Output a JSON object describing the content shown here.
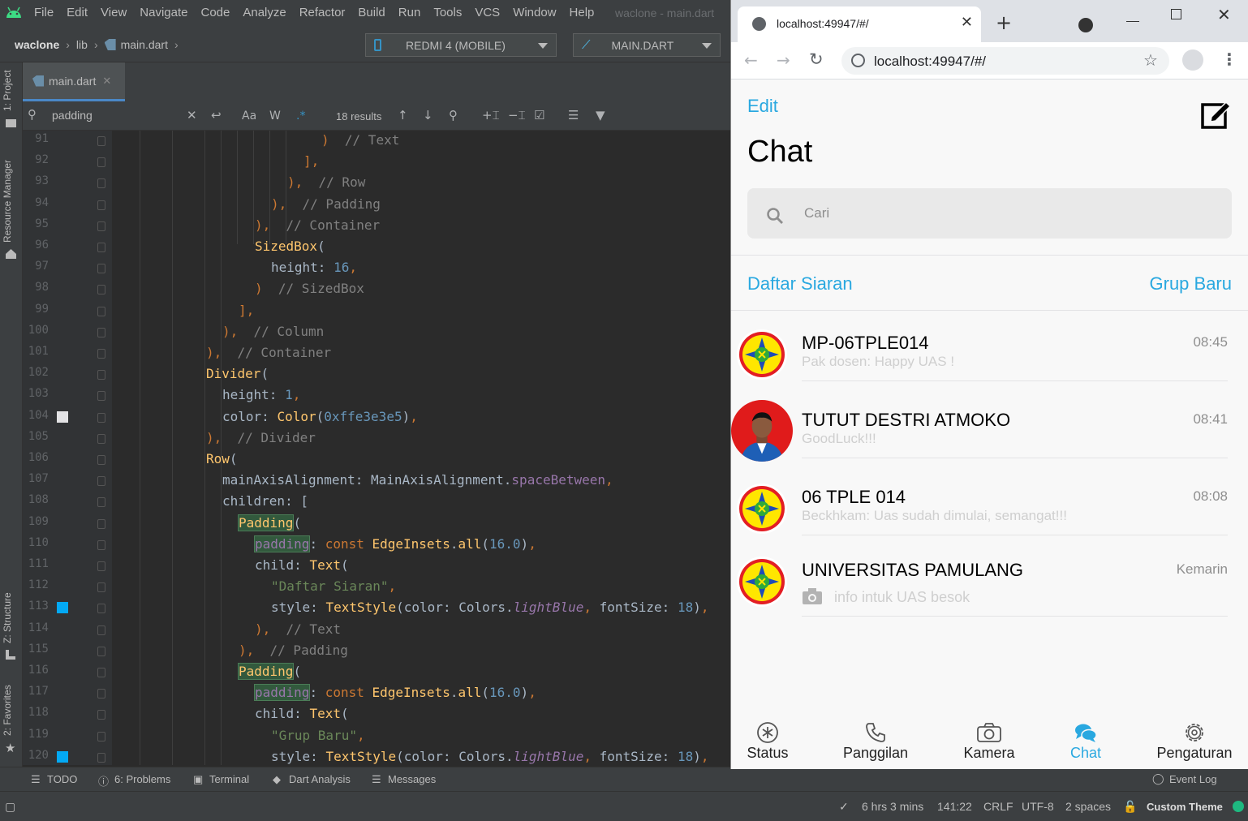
{
  "ide": {
    "menus": [
      "File",
      "Edit",
      "View",
      "Navigate",
      "Code",
      "Analyze",
      "Refactor",
      "Build",
      "Run",
      "Tools",
      "VCS",
      "Window",
      "Help"
    ],
    "window_title": "waclone - main.dart",
    "breadcrumb": {
      "project": "waclone",
      "folder": "lib",
      "file": "main.dart"
    },
    "device": "REDMI 4 (MOBILE)",
    "run_config": "MAIN.DART",
    "left_tabs": [
      "1: Project",
      "Resource Manager",
      "Z: Structure",
      "2: Favorites"
    ],
    "editor_tab": "main.dart",
    "search": {
      "query": "padding",
      "results": "18 results",
      "aa": "Aa",
      "w": "W",
      "regex": ".*"
    },
    "line_numbers": [
      "91",
      "92",
      "93",
      "94",
      "95",
      "96",
      "97",
      "98",
      "99",
      "100",
      "101",
      "102",
      "103",
      "104",
      "105",
      "106",
      "107",
      "108",
      "109",
      "110",
      "111",
      "112",
      "113",
      "114",
      "115",
      "116",
      "117",
      "118",
      "119",
      "120"
    ],
    "bottom_tools": [
      "TODO",
      "6: Problems",
      "Terminal",
      "Dart Analysis",
      "Messages"
    ],
    "event_log": "Event Log",
    "status": {
      "time_spent": "6 hrs 3 mins",
      "position": "141:22",
      "line_sep": "CRLF",
      "encoding": "UTF-8",
      "indent": "2 spaces",
      "theme": "Custom Theme"
    }
  },
  "browser": {
    "tab_title": "localhost:49947/#/",
    "url": "localhost:49947/#/"
  },
  "app": {
    "edit_label": "Edit",
    "title": "Chat",
    "search_placeholder": "Cari",
    "broadcast_label": "Daftar Siaran",
    "new_group_label": "Grup Baru",
    "chats": [
      {
        "name": "MP-06TPLE014",
        "message": "Pak dosen: Happy UAS !",
        "time": "08:45",
        "avatar": "logo"
      },
      {
        "name": "TUTUT DESTRI ATMOKO",
        "message": "GoodLuck!!!",
        "time": "08:41",
        "avatar": "photo"
      },
      {
        "name": "06 TPLE 014",
        "message": "Beckhkam: Uas sudah dimulai, semangat!!!",
        "time": "08:08",
        "avatar": "logo"
      },
      {
        "name": "UNIVERSITAS PAMULANG",
        "message": "info intuk UAS besok",
        "time": "Kemarin",
        "avatar": "logo"
      }
    ],
    "nav": [
      {
        "label": "Status",
        "icon": "status-icon",
        "active": false
      },
      {
        "label": "Panggilan",
        "icon": "phone-icon",
        "active": false
      },
      {
        "label": "Kamera",
        "icon": "camera-icon",
        "active": false
      },
      {
        "label": "Chat",
        "icon": "chat-bubbles-icon",
        "active": true
      },
      {
        "label": "Pengaturan",
        "icon": "settings-gear-icon",
        "active": false
      }
    ],
    "colors": {
      "accent": "#29a8e0",
      "background": "#f8f8f8"
    }
  },
  "code_lines": [
    {
      "t": [
        [
          "c",
          "// Text"
        ]
      ],
      "pre": ")  "
    },
    {
      "pre": "],"
    },
    {
      "pre": "),  ",
      "t": [
        [
          "c",
          "// Row"
        ]
      ]
    },
    {
      "pre": "),  ",
      "t": [
        [
          "c",
          "// Padding"
        ]
      ]
    },
    {
      "pre": "),  ",
      "t": [
        [
          "c",
          "// Container"
        ]
      ]
    },
    {
      "t": [
        [
          "cls",
          "SizedBox"
        ],
        [
          "p",
          "("
        ]
      ]
    },
    {
      "t": [
        [
          "p",
          "height: "
        ],
        [
          "n",
          "16"
        ],
        [
          "k",
          ","
        ]
      ]
    },
    {
      "pre": ")  ",
      "t": [
        [
          "c",
          "// SizedBox"
        ]
      ]
    },
    {
      "pre": "],"
    },
    {
      "pre": "),  ",
      "t": [
        [
          "c",
          "// Column"
        ]
      ]
    },
    {
      "pre": "),  ",
      "t": [
        [
          "c",
          "// Container"
        ]
      ]
    },
    {
      "t": [
        [
          "cls",
          "Divider"
        ],
        [
          "p",
          "("
        ]
      ]
    },
    {
      "t": [
        [
          "p",
          "height: "
        ],
        [
          "n",
          "1"
        ],
        [
          "k",
          ","
        ]
      ]
    },
    {
      "t": [
        [
          "p",
          "color: "
        ],
        [
          "cls",
          "Color"
        ],
        [
          "p",
          "("
        ],
        [
          "n",
          "0xffe3e3e5"
        ],
        [
          "p",
          ")"
        ],
        [
          "k",
          ","
        ]
      ]
    },
    {
      "pre": "),  ",
      "t": [
        [
          "c",
          "// Divider"
        ]
      ]
    },
    {
      "t": [
        [
          "cls",
          "Row"
        ],
        [
          "p",
          "("
        ]
      ]
    },
    {
      "t": [
        [
          "p",
          "mainAxisAlignment: MainAxisAlignment."
        ],
        [
          "f",
          "spaceBetween"
        ],
        [
          "k",
          ","
        ]
      ]
    },
    {
      "t": [
        [
          "p",
          "children: ["
        ]
      ]
    },
    {
      "t": [
        [
          "hlcls",
          "Padding"
        ],
        [
          "p",
          "("
        ]
      ]
    },
    {
      "t": [
        [
          "hl",
          "padding"
        ],
        [
          "p",
          ": "
        ],
        [
          "k",
          "const "
        ],
        [
          "cls",
          "EdgeInsets"
        ],
        [
          "p",
          "."
        ],
        [
          "cls",
          "all"
        ],
        [
          "p",
          "("
        ],
        [
          "n",
          "16.0"
        ],
        [
          "p",
          ")"
        ],
        [
          "k",
          ","
        ]
      ]
    },
    {
      "t": [
        [
          "p",
          "child: "
        ],
        [
          "cls",
          "Text"
        ],
        [
          "p",
          "("
        ]
      ]
    },
    {
      "t": [
        [
          "s",
          "\"Daftar Siaran\""
        ],
        [
          "k",
          ","
        ]
      ]
    },
    {
      "t": [
        [
          "p",
          "style: "
        ],
        [
          "cls",
          "TextStyle"
        ],
        [
          "p",
          "(color: Colors."
        ],
        [
          "fi",
          "lightBlue"
        ],
        [
          "k",
          ", "
        ],
        [
          "p",
          "fontSize: "
        ],
        [
          "n",
          "18"
        ],
        [
          "p",
          ")"
        ],
        [
          "k",
          ","
        ]
      ]
    },
    {
      "pre": "),  ",
      "t": [
        [
          "c",
          "// Text"
        ]
      ]
    },
    {
      "pre": "),  ",
      "t": [
        [
          "c",
          "// Padding"
        ]
      ]
    },
    {
      "t": [
        [
          "hlcls",
          "Padding"
        ],
        [
          "p",
          "("
        ]
      ]
    },
    {
      "t": [
        [
          "hl",
          "padding"
        ],
        [
          "p",
          ": "
        ],
        [
          "k",
          "const "
        ],
        [
          "cls",
          "EdgeInsets"
        ],
        [
          "p",
          "."
        ],
        [
          "cls",
          "all"
        ],
        [
          "p",
          "("
        ],
        [
          "n",
          "16.0"
        ],
        [
          "p",
          ")"
        ],
        [
          "k",
          ","
        ]
      ]
    },
    {
      "t": [
        [
          "p",
          "child: "
        ],
        [
          "cls",
          "Text"
        ],
        [
          "p",
          "("
        ]
      ]
    },
    {
      "t": [
        [
          "s",
          "\"Grup Baru\""
        ],
        [
          "k",
          ","
        ]
      ]
    },
    {
      "t": [
        [
          "p",
          "style: "
        ],
        [
          "cls",
          "TextStyle"
        ],
        [
          "p",
          "(color: Colors."
        ],
        [
          "fi",
          "lightBlue"
        ],
        [
          "k",
          ", "
        ],
        [
          "p",
          "fontSize: "
        ],
        [
          "n",
          "18"
        ],
        [
          "p",
          ")"
        ],
        [
          "k",
          ","
        ]
      ]
    }
  ]
}
